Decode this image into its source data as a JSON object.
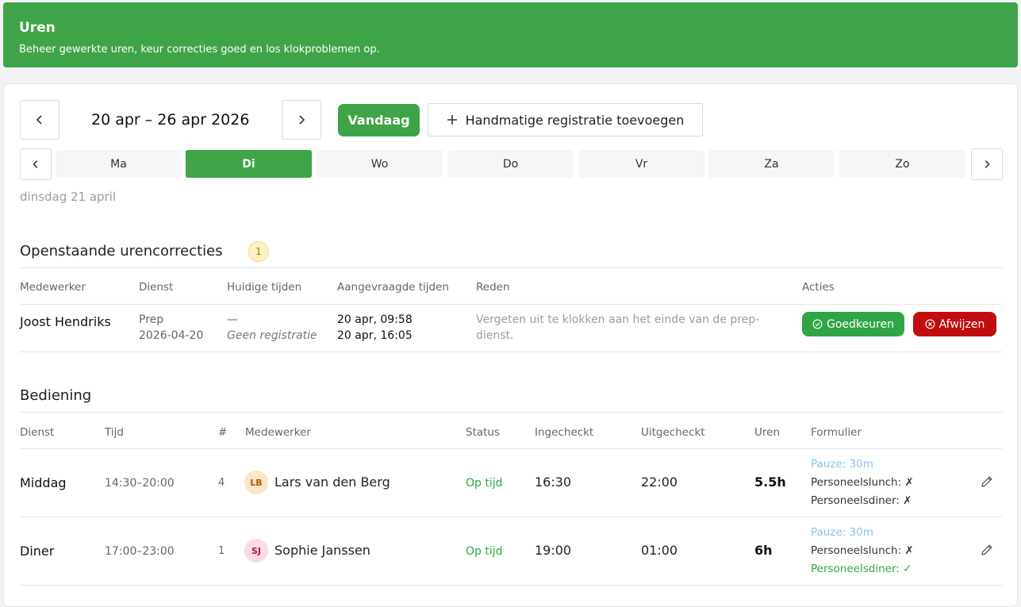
{
  "header": {
    "title": "Uren",
    "subtitle": "Beheer gewerkte uren, keur correcties goed en los klokproblemen op."
  },
  "week": {
    "label": "20 apr – 26 apr 2026",
    "today_label": "Vandaag",
    "add_label": "Handmatige registratie toevoegen"
  },
  "days": [
    {
      "label": "Ma",
      "active": false
    },
    {
      "label": "Di",
      "active": true
    },
    {
      "label": "Wo",
      "active": false
    },
    {
      "label": "Do",
      "active": false
    },
    {
      "label": "Vr",
      "active": false
    },
    {
      "label": "Za",
      "active": false
    },
    {
      "label": "Zo",
      "active": false
    }
  ],
  "selected_date": "dinsdag 21 april",
  "corrections": {
    "title": "Openstaande urencorrecties",
    "count": "1",
    "headers": {
      "employee": "Medewerker",
      "shift": "Dienst",
      "current": "Huidige tijden",
      "requested": "Aangevraagde tijden",
      "reason": "Reden",
      "actions": "Acties"
    },
    "rows": [
      {
        "employee": "Joost Hendriks",
        "shift": "Prep",
        "shift_date": "2026-04-20",
        "current_dash": "—",
        "current_note": "Geen registratie",
        "requested_in": "20 apr, 09:58",
        "requested_out": "20 apr, 16:05",
        "reason_line1": "Vergeten uit te klokken aan het einde van de prep-",
        "reason_line2": "dienst.",
        "approve_label": "Goedkeuren",
        "reject_label": "Afwijzen"
      }
    ]
  },
  "service": {
    "title": "Bediening",
    "headers": {
      "shift": "Dienst",
      "time": "Tijd",
      "number": "#",
      "employee": "Medewerker",
      "status": "Status",
      "checked_in": "Ingecheckt",
      "checked_out": "Uitgecheckt",
      "hours": "Uren",
      "form": "Formulier"
    },
    "rows": [
      {
        "shift": "Middag",
        "time": "14:30–20:00",
        "number": "4",
        "initials": "LB",
        "employee": "Lars van den Berg",
        "status": "Op tijd",
        "checked_in": "16:30",
        "checked_out": "22:00",
        "hours": "5.5h",
        "form_pause": "Pauze: 30m",
        "form_lunch": "Personeelslunch: ✗",
        "form_dinner": "Personeelsdiner: ✗"
      },
      {
        "shift": "Diner",
        "time": "17:00–23:00",
        "number": "1",
        "initials": "SJ",
        "employee": "Sophie Janssen",
        "status": "Op tijd",
        "checked_in": "19:00",
        "checked_out": "01:00",
        "hours": "6h",
        "form_pause": "Pauze: 30m",
        "form_lunch": "Personeelslunch: ✗",
        "form_dinner": "Personeelsdiner: ✓"
      }
    ]
  },
  "colors": {
    "brand": "#3fa447",
    "reject": "#c00e0e",
    "pause": "#8fc0ef"
  }
}
